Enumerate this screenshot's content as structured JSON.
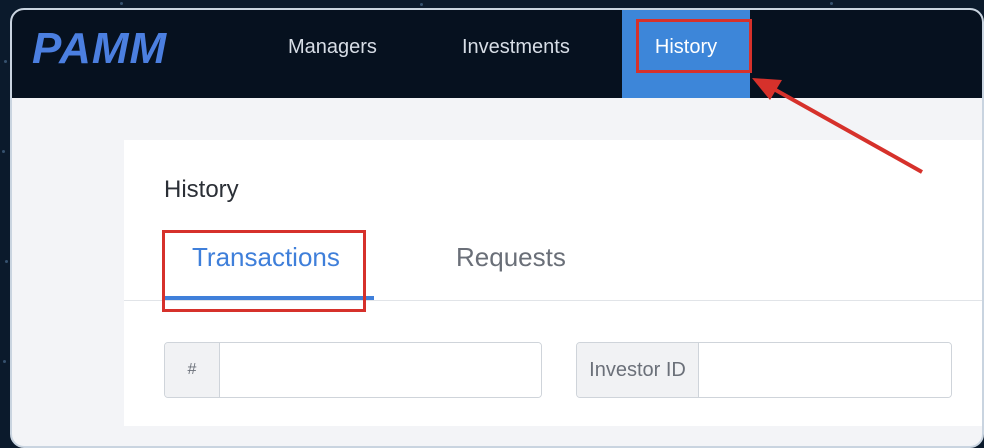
{
  "app": {
    "logo_text": "PAMM"
  },
  "nav": {
    "items": [
      {
        "label": "Managers"
      },
      {
        "label": "Investments"
      },
      {
        "label": "History"
      }
    ],
    "active_index": 2
  },
  "page": {
    "title": "History"
  },
  "tabs": {
    "items": [
      {
        "label": "Transactions"
      },
      {
        "label": "Requests"
      }
    ],
    "active_index": 0
  },
  "filters": {
    "hash": {
      "addon": "#",
      "value": ""
    },
    "investor_id": {
      "addon": "Investor ID",
      "value": ""
    }
  },
  "colors": {
    "accent": "#3d86d9",
    "highlight": "#d6312b",
    "topbar": "#06111f"
  }
}
